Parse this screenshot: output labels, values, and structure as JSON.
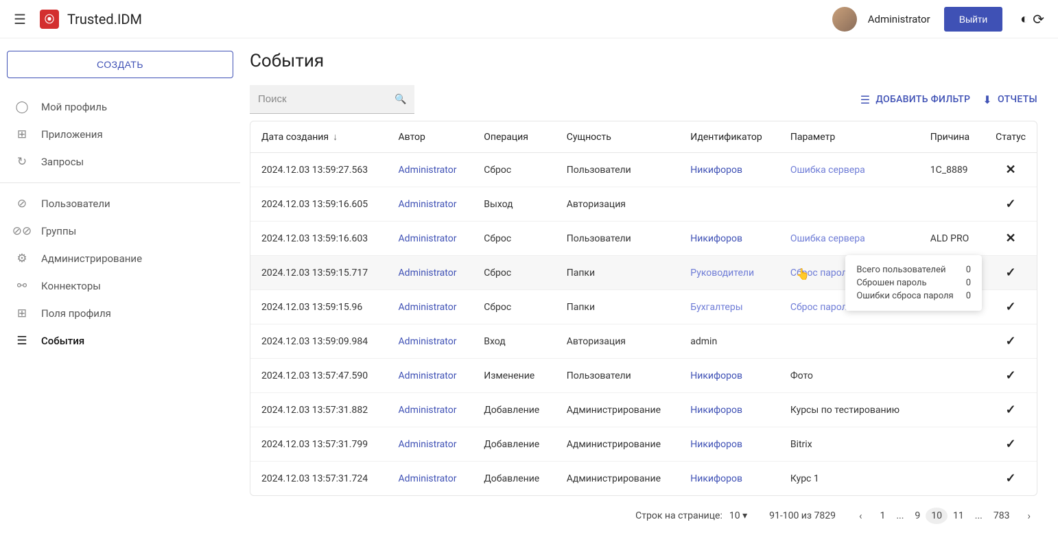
{
  "header": {
    "brand": "Trusted.IDM",
    "user": "Administrator",
    "logout": "Выйти"
  },
  "sidebar": {
    "create": "СОЗДАТЬ",
    "items_top": [
      {
        "icon": "person",
        "label": "Мой профиль"
      },
      {
        "icon": "apps",
        "label": "Приложения"
      },
      {
        "icon": "history",
        "label": "Запросы"
      }
    ],
    "items_mid": [
      {
        "icon": "person2",
        "label": "Пользователи"
      },
      {
        "icon": "people",
        "label": "Группы"
      },
      {
        "icon": "gear",
        "label": "Администрирование"
      },
      {
        "icon": "link",
        "label": "Коннекторы"
      },
      {
        "icon": "profilefields",
        "label": "Поля профиля"
      }
    ],
    "items_active": {
      "icon": "list",
      "label": "События"
    }
  },
  "page": {
    "title": "События",
    "search_placeholder": "Поиск",
    "filter": "ДОБАВИТЬ ФИЛЬТР",
    "reports": "ОТЧЕТЫ"
  },
  "columns": {
    "date": "Дата создания",
    "author": "Автор",
    "operation": "Операция",
    "entity": "Сущность",
    "identifier": "Идентификатор",
    "parameter": "Параметр",
    "reason": "Причина",
    "status": "Статус"
  },
  "rows": [
    {
      "date": "2024.12.03 13:59:27.563",
      "author": "Administrator",
      "op": "Сброс",
      "entity": "Пользователи",
      "ident": "Никифоров",
      "param": "Ошибка сервера",
      "param_light": true,
      "reason": "1С_8889",
      "status": "fail"
    },
    {
      "date": "2024.12.03 13:59:16.605",
      "author": "Administrator",
      "op": "Выход",
      "entity": "Авторизация",
      "ident": "",
      "param": "",
      "reason": "",
      "status": "ok"
    },
    {
      "date": "2024.12.03 13:59:16.603",
      "author": "Administrator",
      "op": "Сброс",
      "entity": "Пользователи",
      "ident": "Никифоров",
      "param": "Ошибка сервера",
      "param_light": true,
      "reason": "ALD PRO",
      "status": "fail"
    },
    {
      "date": "2024.12.03 13:59:15.717",
      "author": "Administrator",
      "op": "Сброс",
      "entity": "Папки",
      "ident": "Руководители",
      "ident_light": true,
      "param": "Сброс пароля",
      "param_light": true,
      "reason": "",
      "status": "ok",
      "hover": true
    },
    {
      "date": "2024.12.03 13:59:15.96",
      "author": "Administrator",
      "op": "Сброс",
      "entity": "Папки",
      "ident": "Бухгалтеры",
      "ident_light": true,
      "param": "Сброс пароля",
      "param_light": true,
      "reason": "",
      "status": "ok"
    },
    {
      "date": "2024.12.03 13:59:09.984",
      "author": "Administrator",
      "op": "Вход",
      "entity": "Авторизация",
      "ident": "admin",
      "ident_plain": true,
      "param": "",
      "reason": "",
      "status": "ok"
    },
    {
      "date": "2024.12.03 13:57:47.590",
      "author": "Administrator",
      "op": "Изменение",
      "entity": "Пользователи",
      "ident": "Никифоров",
      "param": "Фото",
      "param_plain": true,
      "reason": "",
      "status": "ok"
    },
    {
      "date": "2024.12.03 13:57:31.882",
      "author": "Administrator",
      "op": "Добавление",
      "entity": "Администрирование",
      "ident": "Никифоров",
      "param": "Курсы по тестированию",
      "param_plain": true,
      "reason": "",
      "status": "ok"
    },
    {
      "date": "2024.12.03 13:57:31.799",
      "author": "Administrator",
      "op": "Добавление",
      "entity": "Администрирование",
      "ident": "Никифоров",
      "param": "Bitrix",
      "param_plain": true,
      "reason": "",
      "status": "ok"
    },
    {
      "date": "2024.12.03 13:57:31.724",
      "author": "Administrator",
      "op": "Добавление",
      "entity": "Администрирование",
      "ident": "Никифоров",
      "param": "Курс 1",
      "param_plain": true,
      "reason": "",
      "status": "ok"
    }
  ],
  "tooltip": {
    "rows": [
      {
        "label": "Всего пользователей",
        "value": "0"
      },
      {
        "label": "Сброшен пароль",
        "value": "0"
      },
      {
        "label": "Ошибки сброса пароля",
        "value": "0"
      }
    ]
  },
  "pagination": {
    "rows_per_page_label": "Строк на странице:",
    "page_size": "10",
    "range": "91-100 из 7829",
    "pages": [
      "1",
      "...",
      "9",
      "10",
      "11",
      "...",
      "783"
    ],
    "current": "10"
  }
}
